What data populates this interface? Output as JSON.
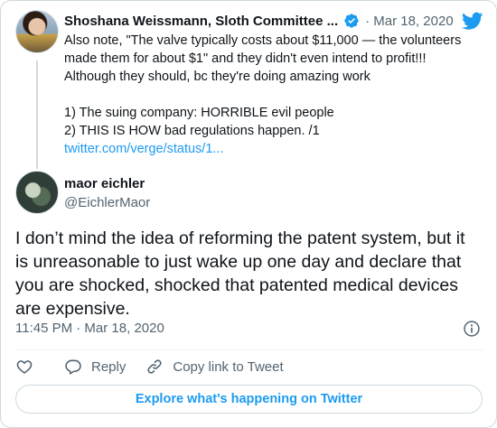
{
  "parent_tweet": {
    "author_name": "Shoshana Weissmann, Sloth Committee ...",
    "date": "· Mar 18, 2020",
    "verified": true,
    "text_lines": [
      "Also note, \"The valve typically costs about $11,000 — the volunteers",
      "made them for about $1\" and they didn't even intend to profit!!!",
      "Although they should, bc they're doing amazing work",
      "",
      "1) The suing company: HORRIBLE evil people",
      "2) THIS IS HOW bad regulations happen. /1"
    ],
    "link": "twitter.com/verge/status/1..."
  },
  "reply_tweet": {
    "author_name": "maor eichler",
    "handle": "@EichlerMaor",
    "text_lines": [
      "I don’t mind the idea of reforming the patent system, but it",
      "is unreasonable to just wake up one day and declare that",
      "you are shocked, shocked that patented medical devices",
      "are expensive."
    ],
    "timestamp": "11:45 PM · Mar 18, 2020"
  },
  "actions": {
    "like_icon": "heart-icon",
    "reply_label": "Reply",
    "copy_link_label": "Copy link to Tweet"
  },
  "explore_label": "Explore what's happening on Twitter",
  "colors": {
    "accent": "#1d9bf0",
    "text": "#0f1419",
    "secondary_text": "#536471",
    "border": "#cfd9de"
  }
}
